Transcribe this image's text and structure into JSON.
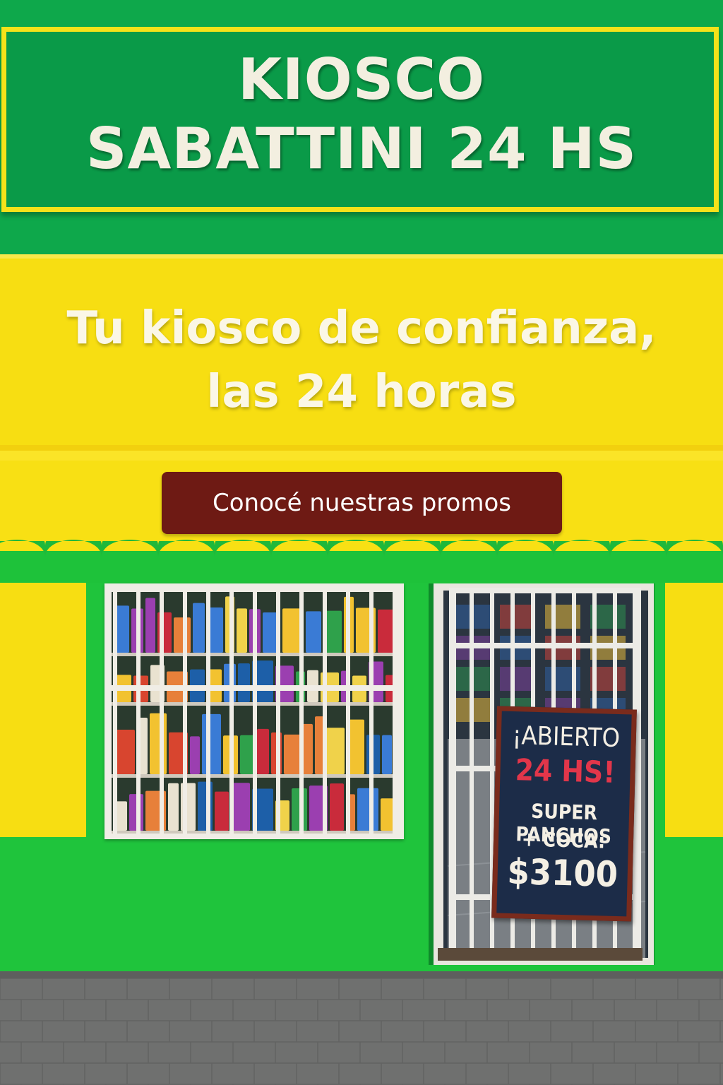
{
  "sign": {
    "title_line1": "KIOSCO",
    "title_line2": "SABATTINI 24 HS"
  },
  "hero": {
    "tagline_line1": "Tu kiosco de confianza,",
    "tagline_line2": "las 24 horas"
  },
  "cta": {
    "label": "Conocé nuestras promos"
  },
  "chalkboard": {
    "line1": "¡ABIERTO",
    "line2": "24 HS!",
    "line3": "SUPER PANCHOS",
    "line4": "+ COCA:",
    "price": "$3100"
  },
  "colors": {
    "brand_green": "#0a9a48",
    "facade_yellow": "#f7de12",
    "storefront_green": "#1fc43c",
    "button_maroon": "#6e1a14",
    "chalk_red": "#e2364a"
  }
}
